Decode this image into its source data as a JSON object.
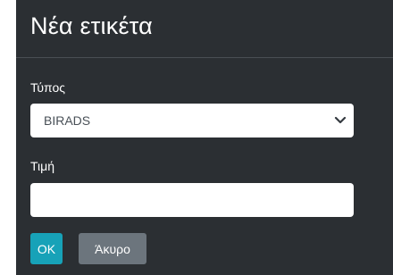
{
  "dialog": {
    "title": "Νέα ετικέτα",
    "type_label": "Τύπος",
    "type_select": {
      "selected": "BIRADS",
      "icon": "chevron-down-icon"
    },
    "value_label": "Τιμή",
    "value_input": {
      "value": "",
      "placeholder": ""
    },
    "ok_label": "OK",
    "cancel_label": "Άκυρο"
  },
  "colors": {
    "background": "#2b2f33",
    "ok_button": "#17a2b8",
    "cancel_button": "#6c757d"
  }
}
